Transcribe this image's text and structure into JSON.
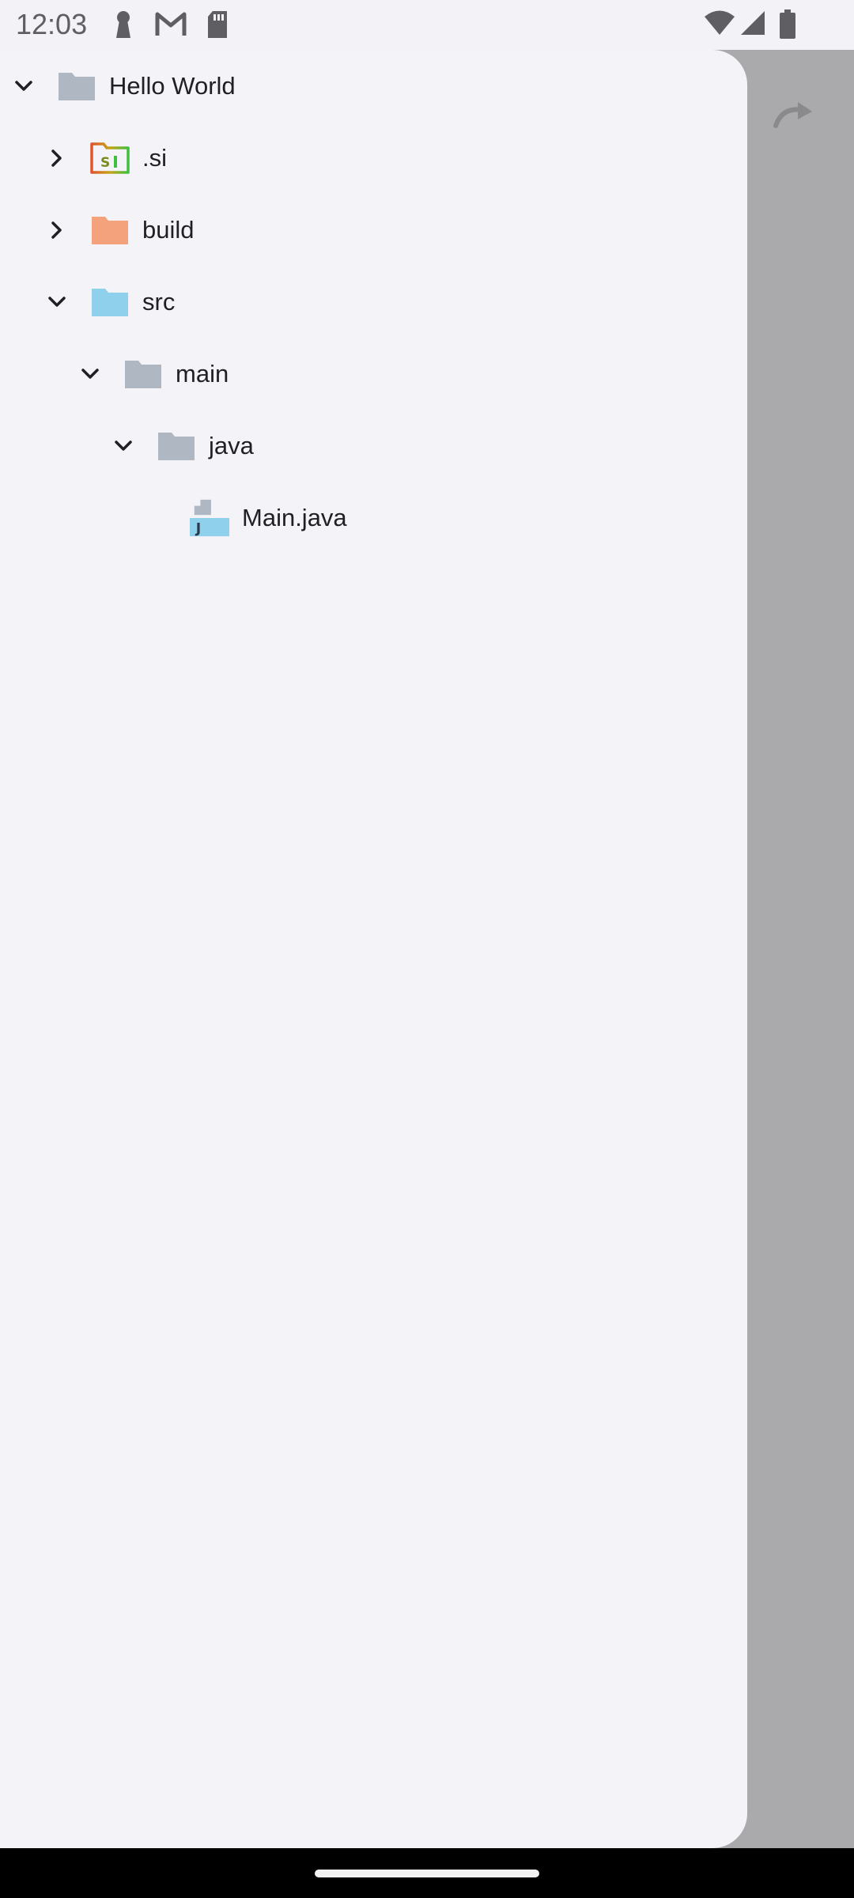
{
  "status_bar": {
    "time": "12:03",
    "left_icons": [
      "keyhole-icon",
      "gmail-icon",
      "sd-card-icon"
    ],
    "right_icons": [
      "wifi-icon",
      "signal-icon",
      "battery-icon"
    ]
  },
  "file_tree": {
    "items": [
      {
        "label": "Hello World",
        "icon": "folder-icon",
        "expanded": true,
        "color": "#aeb7c2"
      },
      {
        "label": ".si",
        "icon": "si-folder-icon",
        "expanded": false
      },
      {
        "label": "build",
        "icon": "folder-icon",
        "expanded": false,
        "color": "#f4a27b"
      },
      {
        "label": "src",
        "icon": "folder-icon",
        "expanded": true,
        "color": "#8fd0ec"
      },
      {
        "label": "main",
        "icon": "folder-icon",
        "expanded": true,
        "color": "#aeb7c2"
      },
      {
        "label": "java",
        "icon": "folder-icon",
        "expanded": true,
        "color": "#aeb7c2"
      },
      {
        "label": "Main.java",
        "icon": "java-file-icon"
      }
    ]
  },
  "background_toolbar": {
    "icon": "redo-icon"
  }
}
